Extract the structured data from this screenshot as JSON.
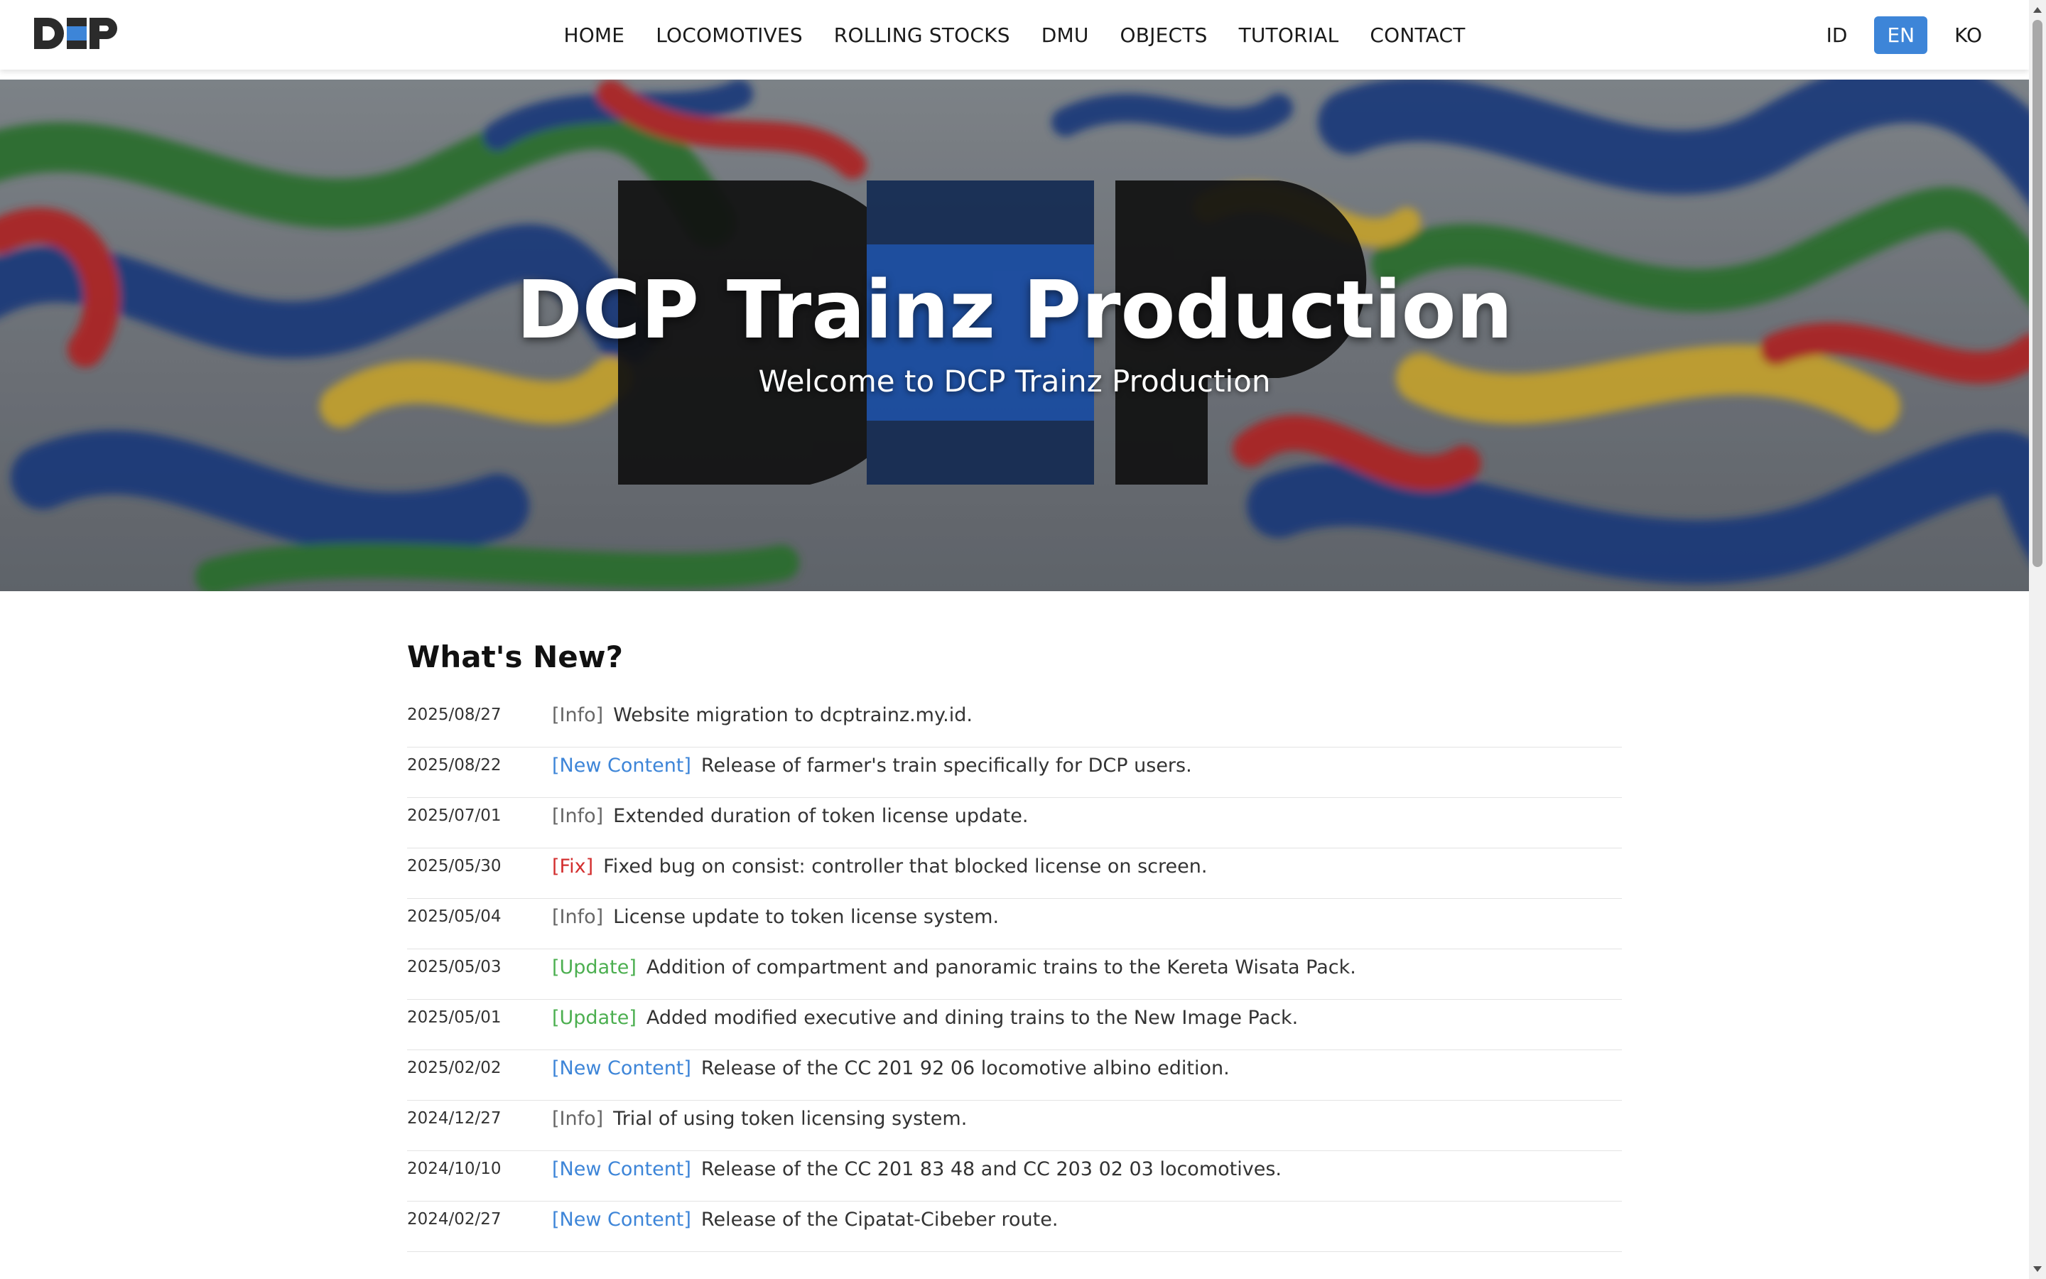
{
  "nav": {
    "logo_text": "DCP",
    "links": [
      {
        "label": "HOME"
      },
      {
        "label": "LOCOMOTIVES"
      },
      {
        "label": "ROLLING STOCKS"
      },
      {
        "label": "DMU"
      },
      {
        "label": "OBJECTS"
      },
      {
        "label": "TUTORIAL"
      },
      {
        "label": "CONTACT"
      }
    ],
    "languages": [
      {
        "label": "ID",
        "active": false
      },
      {
        "label": "EN",
        "active": true
      },
      {
        "label": "KO",
        "active": false
      }
    ]
  },
  "hero": {
    "title": "DCP Trainz Production",
    "subtitle": "Welcome to DCP Trainz Production"
  },
  "news": {
    "heading": "What's New?",
    "tag_colors": {
      "Info": "#666666",
      "New Content": "#3d85d8",
      "Fix": "#d32f2f",
      "Update": "#4caf50"
    },
    "items": [
      {
        "date": "2025/08/27",
        "tag": "[Info]",
        "type": "Info",
        "text": "Website migration to dcptrainz.my.id."
      },
      {
        "date": "2025/08/22",
        "tag": "[New Content]",
        "type": "New Content",
        "text": "Release of farmer's train specifically for DCP users."
      },
      {
        "date": "2025/07/01",
        "tag": "[Info]",
        "type": "Info",
        "text": "Extended duration of token license update."
      },
      {
        "date": "2025/05/30",
        "tag": "[Fix]",
        "type": "Fix",
        "text": "Fixed bug on consist: controller that blocked license on screen."
      },
      {
        "date": "2025/05/04",
        "tag": "[Info]",
        "type": "Info",
        "text": "License update to token license system."
      },
      {
        "date": "2025/05/03",
        "tag": "[Update]",
        "type": "Update",
        "text": "Addition of compartment and panoramic trains to the Kereta Wisata Pack."
      },
      {
        "date": "2025/05/01",
        "tag": "[Update]",
        "type": "Update",
        "text": "Added modified executive and dining trains to the New Image Pack."
      },
      {
        "date": "2025/02/02",
        "tag": "[New Content]",
        "type": "New Content",
        "text": "Release of the CC 201 92 06 locomotive albino edition."
      },
      {
        "date": "2024/12/27",
        "tag": "[Info]",
        "type": "Info",
        "text": "Trial of using token licensing system."
      },
      {
        "date": "2024/10/10",
        "tag": "[New Content]",
        "type": "New Content",
        "text": "Release of the CC 201 83 48 and CC 203 02 03 locomotives."
      },
      {
        "date": "2024/02/27",
        "tag": "[New Content]",
        "type": "New Content",
        "text": "Release of the Cipatat-Cibeber route."
      }
    ]
  }
}
